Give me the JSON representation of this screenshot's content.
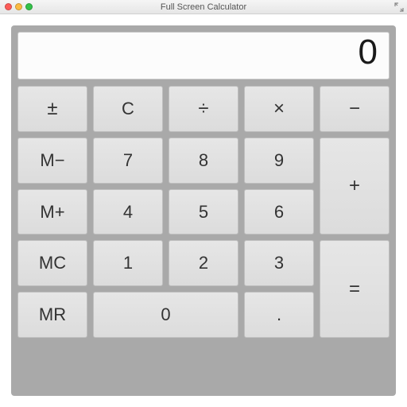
{
  "window": {
    "title": "Full Screen Calculator"
  },
  "display": {
    "value": "0"
  },
  "keys": {
    "plusminus": "±",
    "clear": "C",
    "divide": "÷",
    "multiply": "×",
    "subtract": "−",
    "mem_sub": "M−",
    "seven": "7",
    "eight": "8",
    "nine": "9",
    "mem_add": "M+",
    "four": "4",
    "five": "5",
    "six": "6",
    "add": "+",
    "mem_clear": "MC",
    "one": "1",
    "two": "2",
    "three": "3",
    "mem_recall": "MR",
    "zero": "0",
    "decimal": ".",
    "equals": "="
  }
}
